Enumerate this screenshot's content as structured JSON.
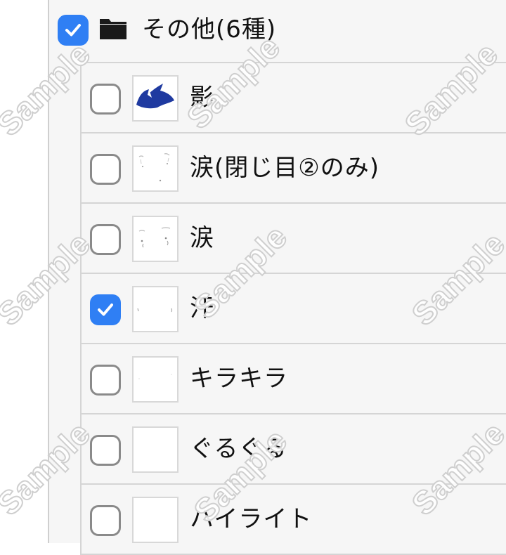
{
  "folder": {
    "label": "その他(6種)",
    "checked": true,
    "icon": "folder-icon"
  },
  "layers": [
    {
      "label": "影",
      "checked": false,
      "thumb": "shadow"
    },
    {
      "label": "涙(閉じ目②のみ)",
      "checked": false,
      "thumb": "tears-closed"
    },
    {
      "label": "涙",
      "checked": false,
      "thumb": "tears"
    },
    {
      "label": "汗",
      "checked": true,
      "thumb": "sweat"
    },
    {
      "label": "キラキラ",
      "checked": false,
      "thumb": "sparkle"
    },
    {
      "label": "ぐるぐる",
      "checked": false,
      "thumb": "swirl"
    },
    {
      "label": "ハイライト",
      "checked": false,
      "thumb": "highlight"
    }
  ],
  "watermark": "Sample",
  "colors": {
    "checkbox_checked": "#2f7ff4",
    "checkbox_border": "#8a8a8a",
    "panel_bg": "#f6f6f6",
    "divider": "#d5d5d5",
    "shadow_thumb": "#1f3aa0"
  }
}
